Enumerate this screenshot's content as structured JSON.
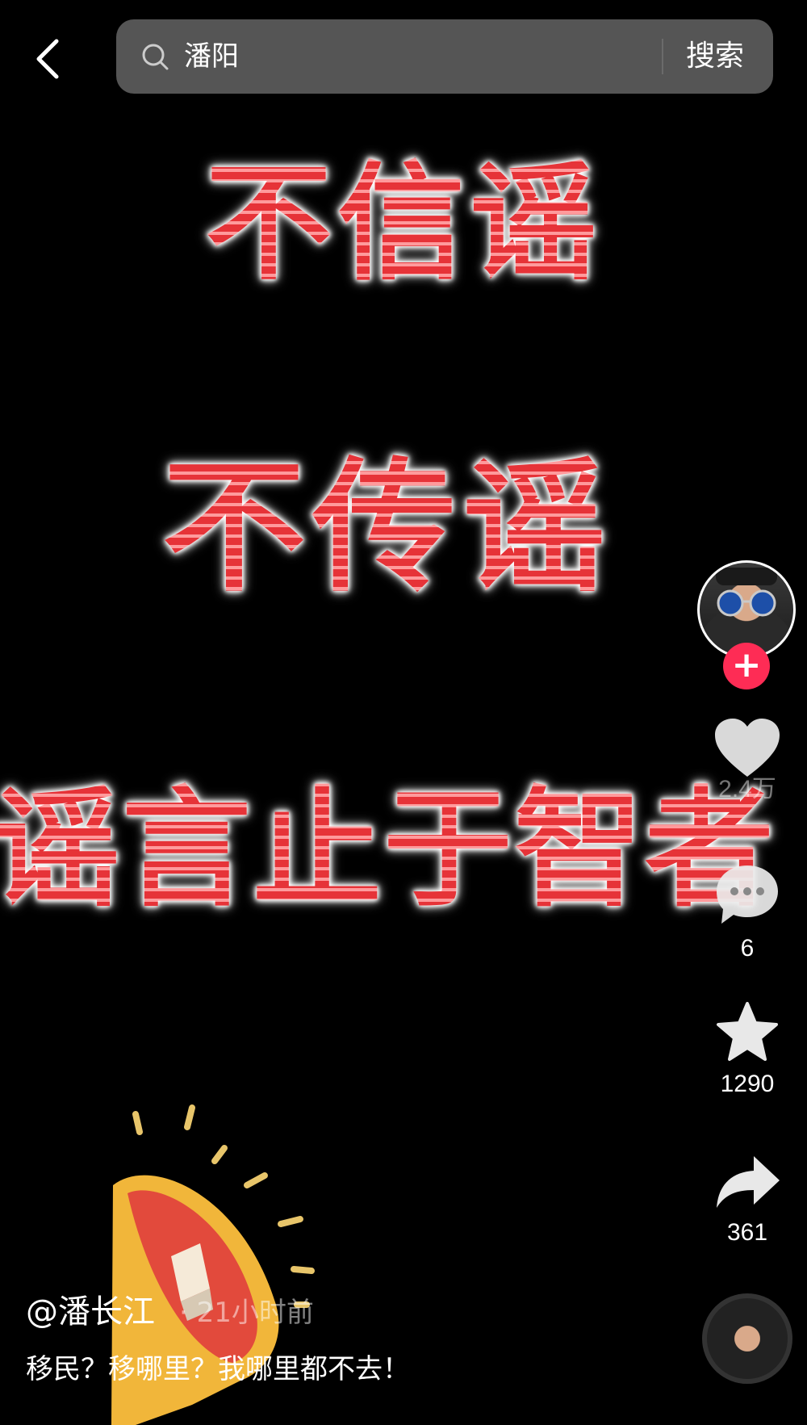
{
  "search": {
    "query": "潘阳",
    "button_label": "搜索"
  },
  "captions": {
    "line1": "不信谣",
    "line2": "不传谣",
    "line3": "谣言止于智者"
  },
  "rail": {
    "likes": "2.4万",
    "comments": "6",
    "favorites": "1290",
    "shares": "361",
    "follow_label": "+"
  },
  "video": {
    "author": "@潘长江",
    "time": "· 21小时前",
    "description": "移民？移哪里？我哪里都不去！"
  },
  "icons": [
    "back-icon",
    "search-icon",
    "heart-icon",
    "comment-icon",
    "star-icon",
    "share-icon",
    "megaphone-icon"
  ],
  "colors": {
    "caption_red": "#e63338",
    "follow_pink": "#fe2c55",
    "search_bg": "#555555"
  }
}
